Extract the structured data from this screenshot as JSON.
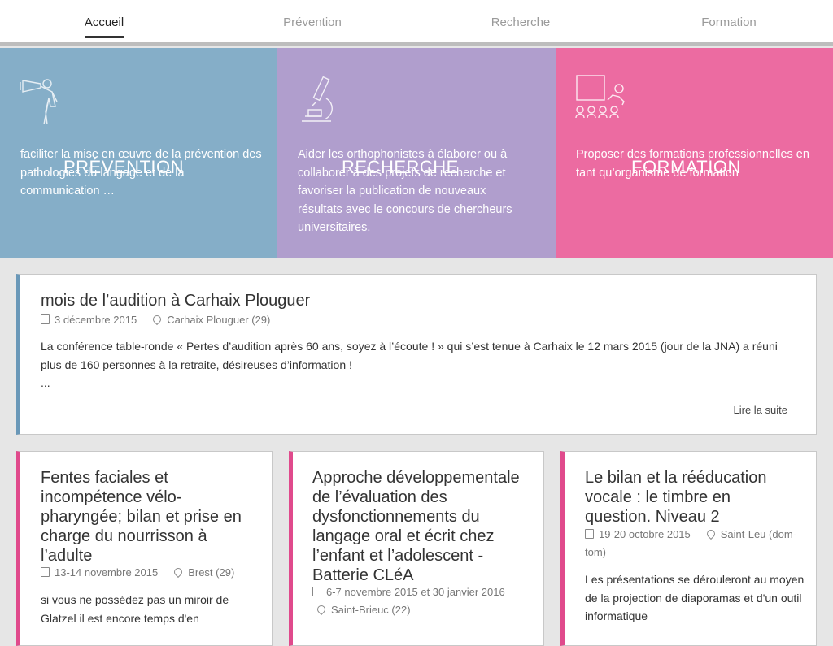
{
  "nav": {
    "items": [
      "Accueil",
      "Prévention",
      "Recherche",
      "Formation"
    ]
  },
  "tiles": [
    {
      "title": "PRÉVENTION",
      "text": "faciliter la mise en œuvre de la prévention des pathologies du langage et de la communication …",
      "icon": "megaphone-icon",
      "color": "#85aec8"
    },
    {
      "title": "RECHERCHE",
      "text": "Aider les orthophonistes à élaborer ou à collaborer à des projets de recherche et favoriser la publication de nouveaux résultats avec le concours de chercheurs universitaires.",
      "icon": "microscope-icon",
      "color": "#b09ecd"
    },
    {
      "title": "FORMATION",
      "text": "Proposer des formations professionnelles en tant qu’organisme de formation",
      "icon": "classroom-icon",
      "color": "#ec6ba1"
    }
  ],
  "featured": {
    "title": "mois de l’audition à Carhaix Plouguer",
    "date": "3 décembre 2015",
    "place": "Carhaix Plouguer (29)",
    "text": "La conférence table-ronde « Pertes d’audition après 60 ans, soyez à l’écoute ! » qui s’est tenue à Carhaix le 12 mars 2015 (jour de la JNA) a réuni plus de 160 personnes à la retraite, désireuses d’information !",
    "ellipsis": "...",
    "readmore": "Lire la suite"
  },
  "courses": [
    {
      "title": "Fentes faciales et incompétence vélo-pharyngée; bilan et prise en charge du nourrisson à l’adulte",
      "date": "13-14 novembre 2015",
      "place": "Brest (29)",
      "text": "si vous ne possédez pas un miroir de Glatzel il est encore temps d'en"
    },
    {
      "title": "Approche développementale de l’évaluation des dysfonctionnements du langage oral et écrit chez l’enfant et l’adolescent - Batterie CLéA",
      "date": "6-7 novembre 2015 et 30 janvier 2016",
      "place": "Saint-Brieuc (22)",
      "text": ""
    },
    {
      "title": "Le bilan et la rééducation vocale : le timbre en question. Niveau 2",
      "date": "19-20 octobre 2015",
      "place": "Saint-Leu (dom-tom)",
      "text": "Les présentations se dérouleront au moyen de la projection de diaporamas et d'un outil informatique"
    }
  ]
}
